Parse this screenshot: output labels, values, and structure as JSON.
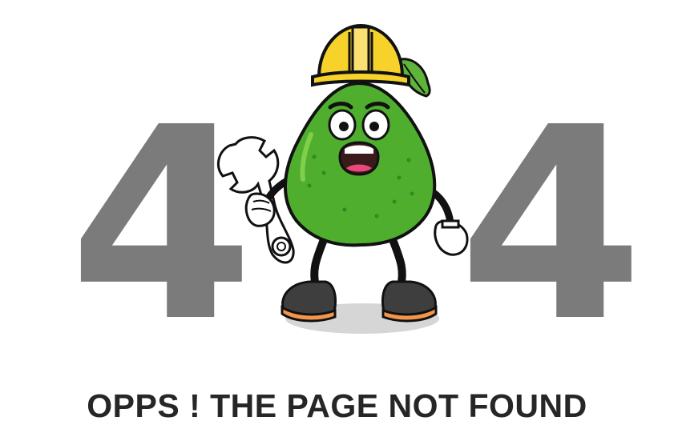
{
  "error_page": {
    "code_digit_left": "4",
    "code_digit_right": "4",
    "message": "OPPS ! THE PAGE NOT FOUND",
    "illustration_icon": "avocado-mascot-icon"
  },
  "colors": {
    "digits": "#7b7b7b",
    "message_text": "#262626",
    "background": "#ffffff",
    "avocado_skin": "#4fae2e",
    "helmet": "#f6d22b",
    "shoes": "#3e3e3e",
    "soles": "#f3964b",
    "leaf": "#5fb53a"
  }
}
